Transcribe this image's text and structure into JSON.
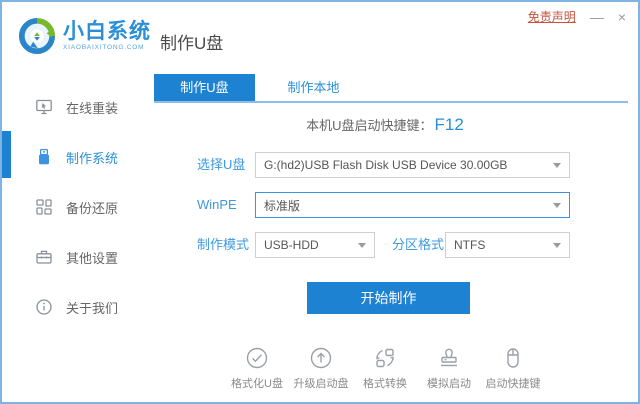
{
  "window": {
    "disclaimer": "免责声明",
    "minimize": "—",
    "close": "×"
  },
  "header": {
    "logo_title": "小白系统",
    "logo_subtitle": "XIAOBAIXITONG.COM",
    "page_title": "制作U盘"
  },
  "sidebar": {
    "items": [
      {
        "label": "在线重装",
        "icon": "online-reinstall-icon",
        "active": false
      },
      {
        "label": "制作系统",
        "icon": "usb-drive-icon",
        "active": true
      },
      {
        "label": "备份还原",
        "icon": "backup-restore-icon",
        "active": false
      },
      {
        "label": "其他设置",
        "icon": "toolbox-icon",
        "active": false
      },
      {
        "label": "关于我们",
        "icon": "info-icon",
        "active": false
      }
    ]
  },
  "tabs": [
    {
      "label": "制作U盘",
      "active": true
    },
    {
      "label": "制作本地",
      "active": false
    }
  ],
  "main": {
    "hotkey_label": "本机U盘启动快捷键：",
    "hotkey_value": "F12",
    "form": {
      "rows": [
        {
          "label": "选择U盘",
          "value": "G:(hd2)USB Flash Disk USB Device 30.00GB"
        },
        {
          "label": "WinPE",
          "value": "标准版"
        },
        {
          "label": "制作模式",
          "value": "USB-HDD"
        },
        {
          "label": "分区格式",
          "value": "NTFS"
        }
      ]
    },
    "start_button": "开始制作"
  },
  "footer": {
    "tools": [
      {
        "label": "格式化U盘",
        "icon": "format-usb-icon"
      },
      {
        "label": "升级启动盘",
        "icon": "upgrade-bootdisk-icon"
      },
      {
        "label": "格式转换",
        "icon": "format-convert-icon"
      },
      {
        "label": "模拟启动",
        "icon": "simulate-boot-icon"
      },
      {
        "label": "启动快捷键",
        "icon": "boot-hotkey-icon"
      }
    ]
  },
  "colors": {
    "primary": "#1e82d2",
    "label_blue": "#3d9ae1",
    "tab_text_blue": "#2b8fd8",
    "link_red": "#c4533e",
    "window_border": "#7fb3e3"
  }
}
